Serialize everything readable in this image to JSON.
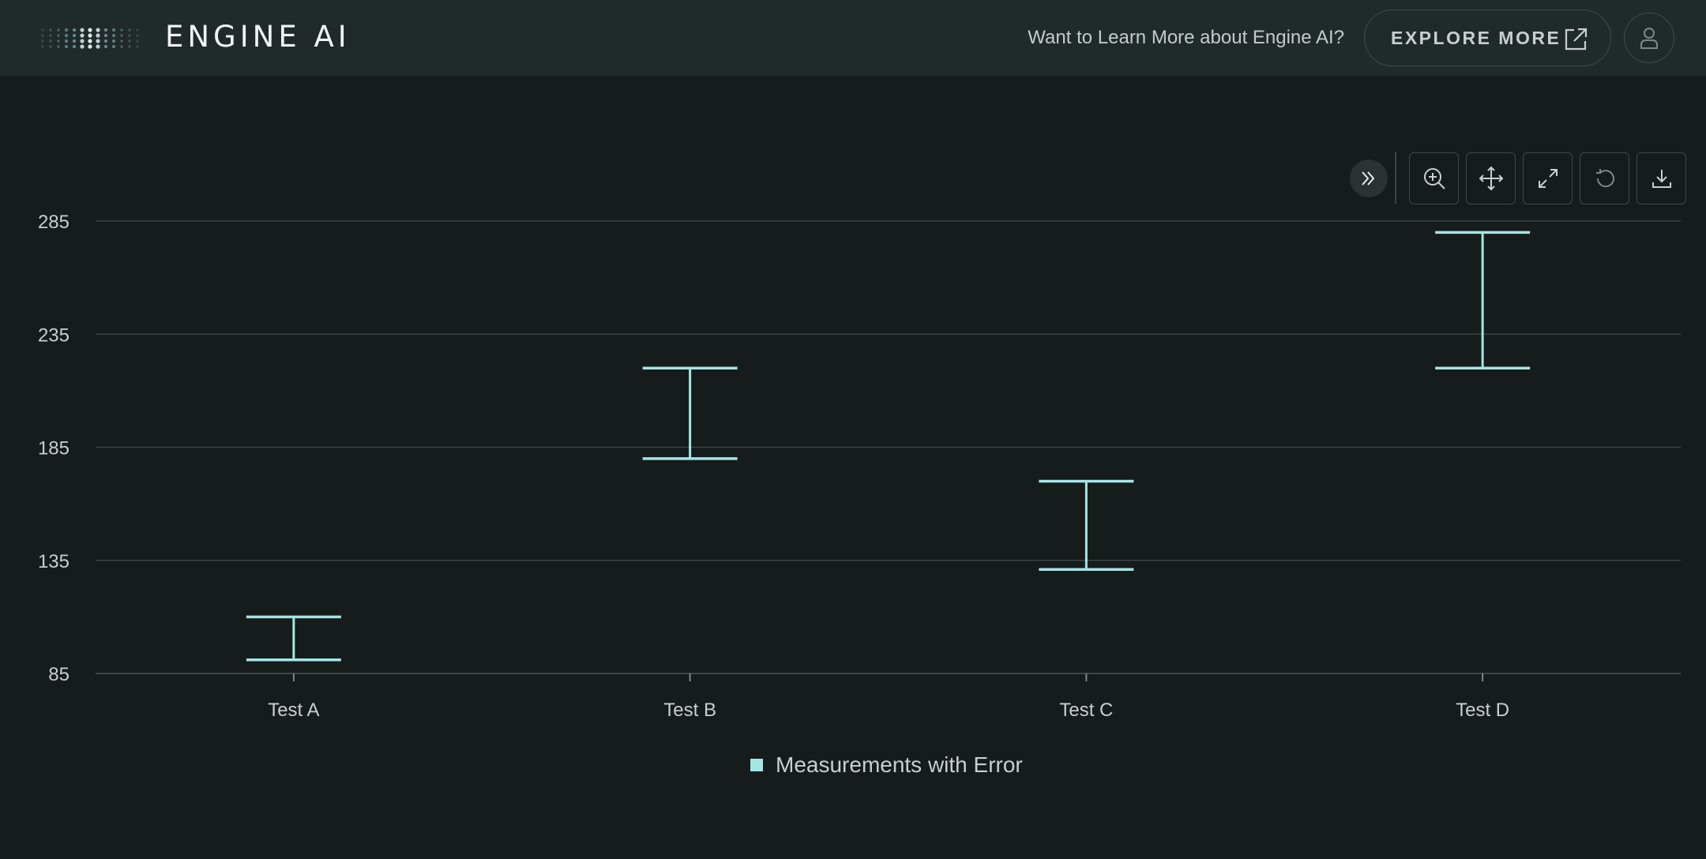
{
  "header": {
    "logo_text": "ENGINE AI",
    "learn_text": "Want to Learn More about Engine AI?",
    "explore_label": "EXPLORE MORE"
  },
  "icons": {
    "logo": "dots-logo-icon",
    "explore": "external-link-icon",
    "user": "user-icon",
    "collapse": "double-chevron-right-icon",
    "zoom": "zoom-in-icon",
    "pan": "move-icon",
    "reset_zoom": "expand-icon",
    "reset": "undo-icon",
    "download": "download-icon"
  },
  "colors": {
    "background": "#161b1b",
    "header": "#212a2b",
    "series": "#a3e6e6",
    "grid": "#3a4445"
  },
  "chart_data": {
    "type": "errorbar",
    "categories": [
      "Test A",
      "Test B",
      "Test C",
      "Test D"
    ],
    "series": [
      {
        "name": "Measurements with Error",
        "low": [
          91,
          180,
          131,
          220
        ],
        "high": [
          110,
          220,
          170,
          280
        ]
      }
    ],
    "yticks": [
      85,
      135,
      185,
      235,
      285
    ],
    "ylim": [
      85,
      285
    ],
    "grid": true,
    "legend_position": "bottom-center"
  }
}
